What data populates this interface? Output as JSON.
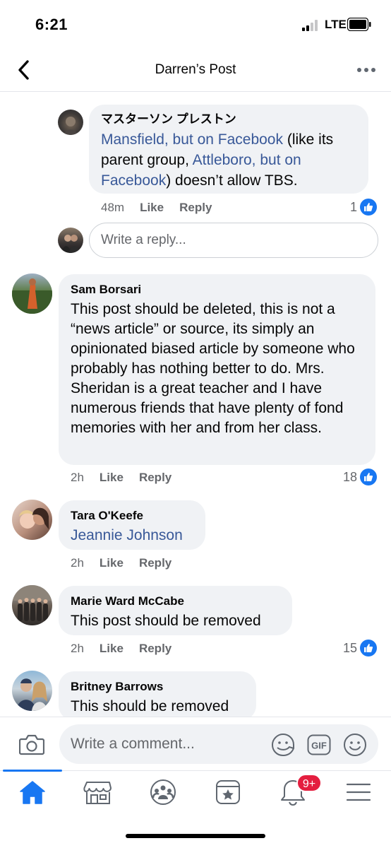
{
  "status_bar": {
    "time": "6:21",
    "network": "LTE"
  },
  "header": {
    "title": "Darren’s Post"
  },
  "comments": [
    {
      "author": "マスターソン プレストン",
      "link1": "Mansfield, but on Facebook",
      "text1": " (like its parent group, ",
      "link2": "Attleboro, but on Facebook",
      "text2": ") doesn’t allow TBS.",
      "time": "48m",
      "like": "Like",
      "reply": "Reply",
      "reactions": "1"
    },
    {
      "author": "Sam Borsari",
      "text": "This post should be deleted, this is not a “news article” or source, its simply an opinionated biased article by someone who probably has nothing better to do. Mrs. Sheridan is a great teacher and I have numerous friends that have plenty of fond memories with her and from her class.",
      "time": "2h",
      "like": "Like",
      "reply": "Reply",
      "reactions": "18"
    },
    {
      "author": "Tara O'Keefe",
      "mention": "Jeannie Johnson",
      "time": "2h",
      "like": "Like",
      "reply": "Reply"
    },
    {
      "author": "Marie Ward McCabe",
      "text": "This post should be removed",
      "time": "2h",
      "like": "Like",
      "reply": "Reply",
      "reactions": "15"
    },
    {
      "author": "Britney Barrows",
      "text": "This should be removed"
    }
  ],
  "reply_box": {
    "placeholder": "Write a reply..."
  },
  "composer": {
    "placeholder": "Write a comment..."
  },
  "tab_bar": {
    "notifications_badge": "9+"
  },
  "colors": {
    "accent": "#1877f2",
    "link": "#385898",
    "badge": "#e41e3f",
    "bubble": "#f0f2f5"
  }
}
